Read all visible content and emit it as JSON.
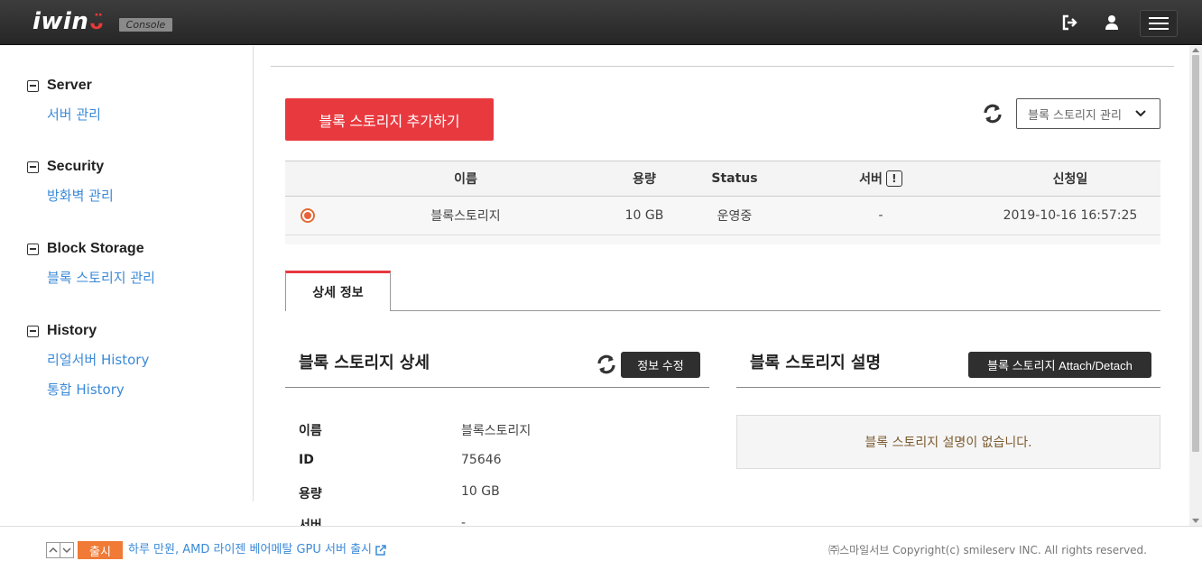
{
  "header": {
    "logo_text": "iwin",
    "console_badge": "Console"
  },
  "sidebar": {
    "groups": [
      {
        "title": "Server",
        "links": [
          "서버 관리"
        ]
      },
      {
        "title": "Security",
        "links": [
          "방화벽 관리"
        ]
      },
      {
        "title": "Block Storage",
        "links": [
          "블록 스토리지 관리"
        ]
      },
      {
        "title": "History",
        "links": [
          "리얼서버 History",
          "통합 History"
        ]
      }
    ]
  },
  "main": {
    "add_button": "블록 스토리지 추가하기",
    "select_value": "블록 스토리지 관리",
    "table": {
      "headers": [
        "이름",
        "용량",
        "Status",
        "서버",
        "신청일"
      ],
      "server_alert": "!",
      "rows": [
        {
          "name": "블록스토리지",
          "size": "10 GB",
          "status": "운영중",
          "server": "-",
          "date": "2019-10-16 16:57:25"
        }
      ]
    },
    "tab_label": "상세 정보",
    "detail_panel": {
      "title": "블록 스토리지 상세",
      "edit_button": "정보 수정",
      "fields": [
        {
          "label": "이름",
          "value": "블록스토리지"
        },
        {
          "label": "ID",
          "value": "75646"
        },
        {
          "label": "용량",
          "value": "10 GB"
        },
        {
          "label": "서버",
          "value": "-"
        }
      ]
    },
    "desc_panel": {
      "title": "블록 스토리지 설명",
      "attach_button": "블록 스토리지 Attach/Detach",
      "empty_text": "블록 스토리지 설명이 없습니다."
    }
  },
  "footer": {
    "news_badge": "출시",
    "news_text": "하루 만원, AMD 라이젠 베어메탈 GPU 서버 출시",
    "copyright": "㈜스마일서브 Copyright(c) smileserv INC. All rights reserved."
  },
  "colors": {
    "accent_red": "#e8393f",
    "link_blue": "#3b8ad9",
    "badge_orange": "#f07a36"
  }
}
